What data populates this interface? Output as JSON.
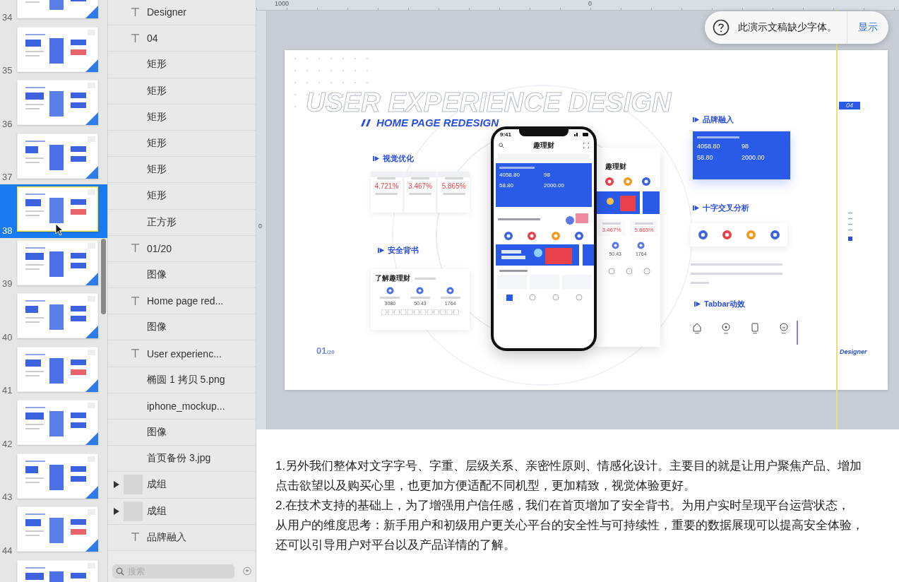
{
  "ruler": {
    "top_labels": [
      "1000",
      "0"
    ],
    "left_label": "0"
  },
  "slides": [
    {
      "number": "34",
      "selected": false
    },
    {
      "number": "35",
      "selected": false
    },
    {
      "number": "36",
      "selected": false
    },
    {
      "number": "37",
      "selected": false
    },
    {
      "number": "38",
      "selected": true
    },
    {
      "number": "39",
      "selected": false
    },
    {
      "number": "40",
      "selected": false
    },
    {
      "number": "41",
      "selected": false
    },
    {
      "number": "42",
      "selected": false
    },
    {
      "number": "43",
      "selected": false
    },
    {
      "number": "44",
      "selected": false
    },
    {
      "selected": false
    }
  ],
  "layers": [
    {
      "kind": "text",
      "name": "Designer"
    },
    {
      "kind": "text",
      "name": "04"
    },
    {
      "kind": "shape",
      "name": "矩形"
    },
    {
      "kind": "shape",
      "name": "矩形"
    },
    {
      "kind": "shape",
      "name": "矩形"
    },
    {
      "kind": "shape",
      "name": "矩形"
    },
    {
      "kind": "shape",
      "name": "矩形"
    },
    {
      "kind": "shape",
      "name": "矩形"
    },
    {
      "kind": "shape",
      "name": "正方形"
    },
    {
      "kind": "text",
      "name": "01/20"
    },
    {
      "kind": "shape",
      "name": "图像"
    },
    {
      "kind": "text",
      "name": "Home page red..."
    },
    {
      "kind": "shape",
      "name": "图像"
    },
    {
      "kind": "text",
      "name": "User experienc..."
    },
    {
      "kind": "shape",
      "name": "椭圆 1 拷贝 5.png"
    },
    {
      "kind": "shape",
      "name": "iphone_mockup..."
    },
    {
      "kind": "shape",
      "name": "图像"
    },
    {
      "kind": "shape",
      "name": "首页备份 3.jpg"
    },
    {
      "kind": "group",
      "name": "成组",
      "expanded": false
    },
    {
      "kind": "group",
      "name": "成组",
      "expanded": false
    },
    {
      "kind": "text",
      "name": "品牌融入"
    }
  ],
  "layer_search": {
    "placeholder": "搜索"
  },
  "notice": {
    "text": "此演示文稿缺少字体。",
    "action": "显示"
  },
  "slide": {
    "watermark": "USER EXPERIENCE DESIGN",
    "title": "HOME PAGE REDESIGN",
    "visual": {
      "heading": "视觉优化",
      "rates": [
        "4.721%",
        "3.467%",
        "5.865%"
      ]
    },
    "security": {
      "heading": "安全背书",
      "card_title": "了解趣理财",
      "values": [
        "3080",
        "50.43",
        "1764"
      ]
    },
    "phone": {
      "time": "9:41",
      "app_title": "趣理财",
      "account_values": [
        "4058.80",
        "98",
        "58.80",
        "2000.00"
      ]
    },
    "phone_back": {
      "app_title": "趣理财",
      "rates": [
        "3.467%",
        "5.865%"
      ],
      "values": [
        "50.43",
        "1764"
      ]
    },
    "brand": {
      "heading": "品牌融入",
      "values": [
        "4058.80",
        "98",
        "58.80",
        "2000.00"
      ]
    },
    "cross": {
      "heading": "十字交叉分析"
    },
    "tabbar": {
      "heading": "Tabbar动效"
    },
    "page_number": "01",
    "page_total": "/20",
    "tag": "04",
    "signature": "Designer"
  },
  "notes": [
    "1.另外我们整体对文字字号、字重、层级关系、亲密性原则、情感化设计。主要目的就是让用户聚焦产品、增加点击欲望以及购买心里，也更加方便适配不同机型，更加精致，视觉体验更好。",
    "2.在技术支持的基础上，为了增强用户信任感，我们在首页增加了安全背书。为用户实时呈现平台运营状态，",
    "从用户的维度思考：新手用户和初级用户更关心平台的安全性与可持续性，重要的数据展现可以提高安全体验，还可以引导用户对平台以及产品详情的了解。"
  ]
}
